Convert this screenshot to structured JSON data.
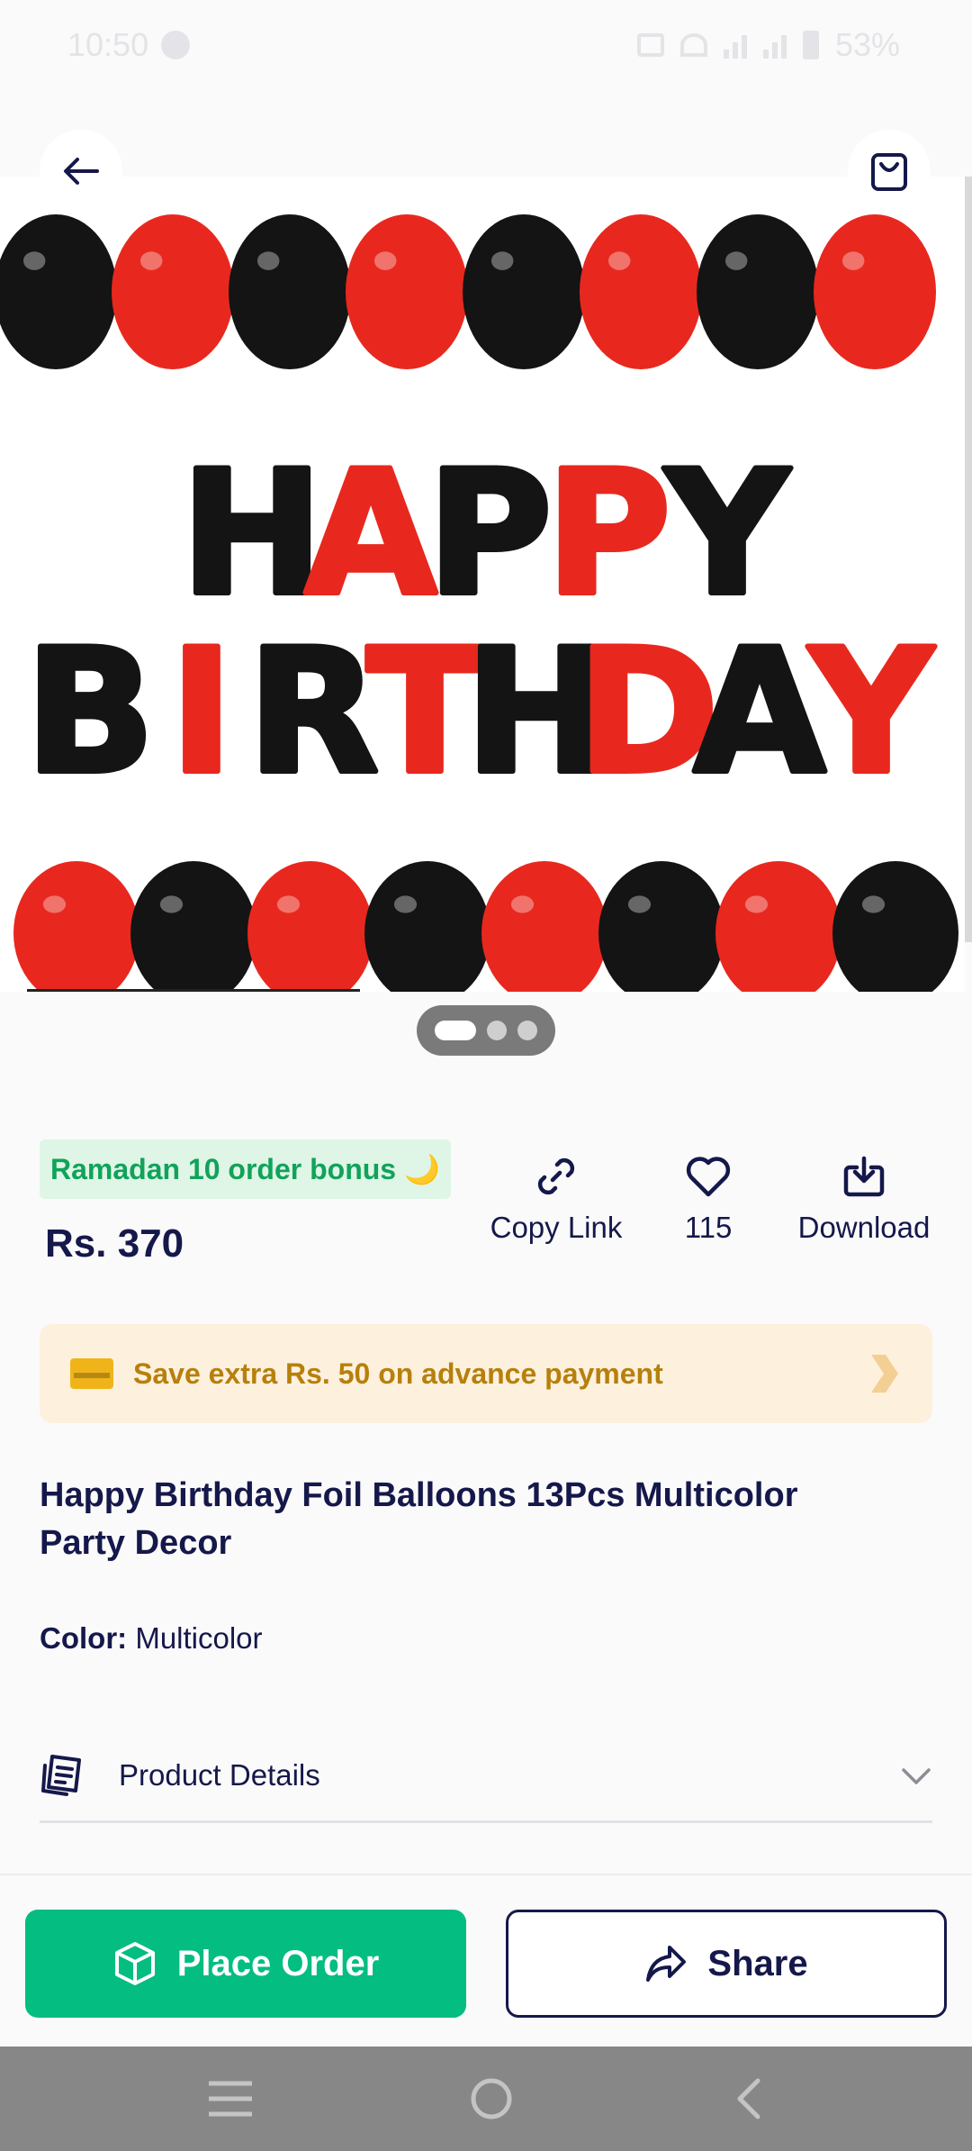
{
  "status_bar": {
    "time": "10:50",
    "battery": "53%"
  },
  "icons": {
    "back": "arrow-left-icon",
    "cart": "shopping-bag-icon",
    "copy_link": "link-icon",
    "like": "heart-icon",
    "download": "download-icon",
    "advance": "credit-card-icon",
    "advance_chevron": "chevron-right-icon",
    "product_details": "document-icon",
    "details_chevron": "chevron-down-icon",
    "place_order": "box-icon",
    "share": "share-arrow-icon",
    "nav_menu": "menu-icon",
    "nav_home": "home-circle-icon",
    "nav_back": "back-chevron-icon"
  },
  "hero": {
    "line1": "HAPPY",
    "line2": "BIRTHDAY",
    "line1_colors": [
      "#141414",
      "#e8281e",
      "#141414",
      "#e8281e",
      "#141414"
    ],
    "line2_colors": [
      "#141414",
      "#e8281e",
      "#141414",
      "#e8281e",
      "#141414",
      "#e8281e",
      "#141414",
      "#e8281e"
    ],
    "pager": {
      "count": 3,
      "active": 0
    }
  },
  "product": {
    "promo_badge": "Ramadan 10 order bonus 🌙",
    "price": "Rs. 370",
    "title": "Happy Birthday Foil Balloons 13Pcs Multicolor Party Decor",
    "color_label": "Color:",
    "color_value": "Multicolor"
  },
  "actions": {
    "copy_link": "Copy Link",
    "likes": "115",
    "download": "Download"
  },
  "advance_payment": {
    "text": "Save extra Rs. 50 on advance payment"
  },
  "details": {
    "label": "Product Details"
  },
  "buttons": {
    "place_order": "Place Order",
    "share": "Share"
  },
  "colors": {
    "accent_green": "#04bd80",
    "navy": "#15184a",
    "promo_green": "#10a35a",
    "advance_bg": "#fdf1de",
    "advance_text": "#b7800c",
    "balloon_red": "#e8281e",
    "balloon_black": "#141414"
  }
}
